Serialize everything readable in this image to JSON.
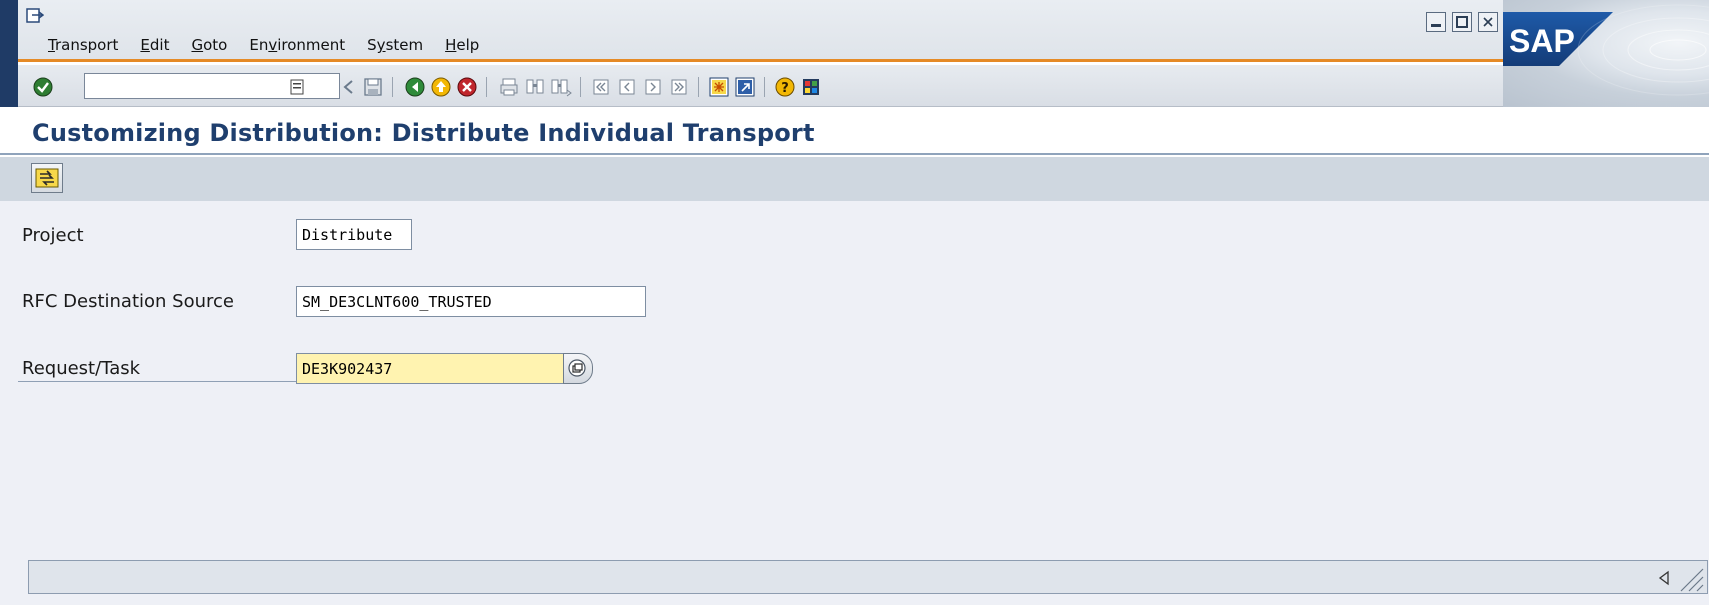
{
  "window": {
    "menu": [
      {
        "prefix": "",
        "ul": "T",
        "rest": "ransport"
      },
      {
        "prefix": "",
        "ul": "E",
        "rest": "dit"
      },
      {
        "prefix": "",
        "ul": "G",
        "rest": "oto"
      },
      {
        "prefix": "En",
        "ul": "v",
        "rest": "ironment"
      },
      {
        "prefix": "S",
        "ul": "y",
        "rest": "stem"
      },
      {
        "prefix": "",
        "ul": "H",
        "rest": "elp"
      }
    ],
    "logo_text": "SAP"
  },
  "toolbar": {
    "command_value": ""
  },
  "page": {
    "title": "Customizing Distribution: Distribute Individual Transport"
  },
  "form": {
    "project_label": "Project",
    "project_value": "Distribute",
    "rfc_label": "RFC Destination Source",
    "rfc_value": "SM_DE3CLNT600_TRUSTED",
    "request_label": "Request/Task",
    "request_value": "DE3K902437"
  },
  "colors": {
    "accent": "#e58a26",
    "title": "#1f3f6e",
    "frame": "#1f3b66",
    "highlight_field": "#fff3b0"
  }
}
